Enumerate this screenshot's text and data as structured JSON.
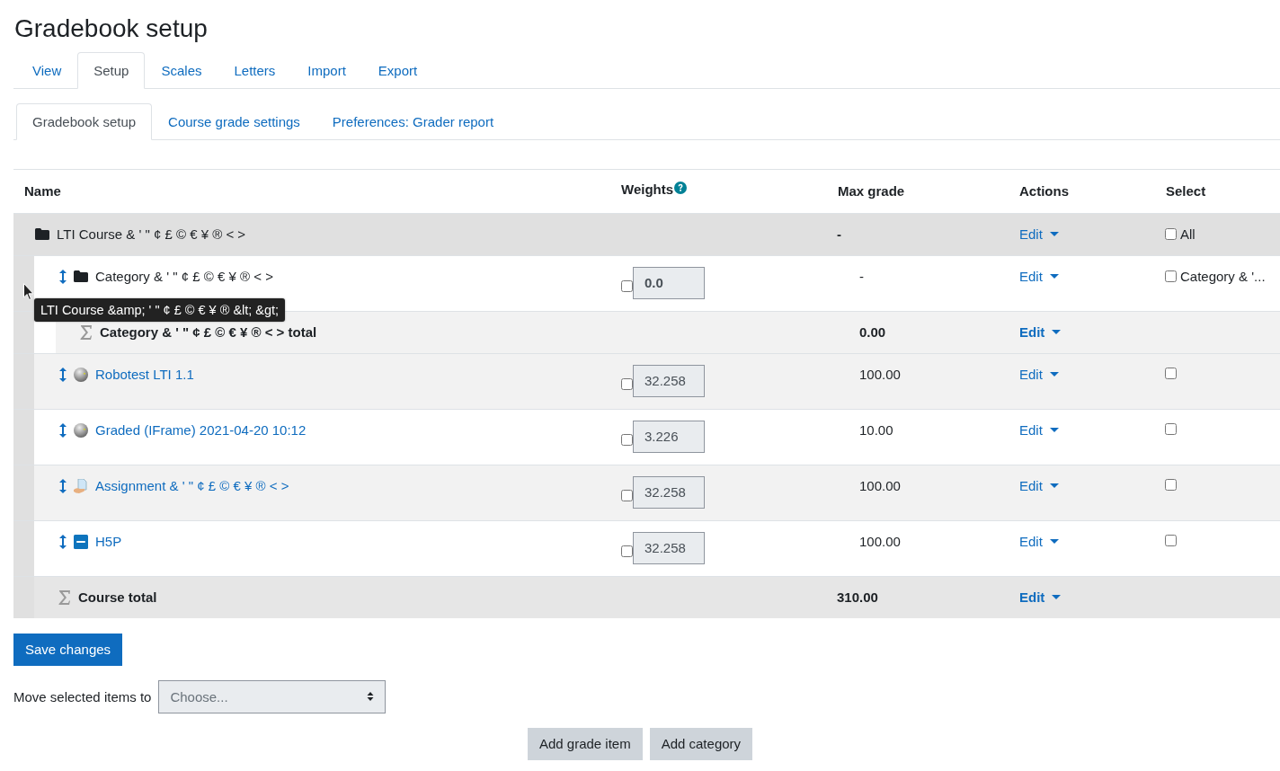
{
  "title": "Gradebook setup",
  "tabs": [
    {
      "label": "View",
      "selected": false
    },
    {
      "label": "Setup",
      "selected": true
    },
    {
      "label": "Scales",
      "selected": false
    },
    {
      "label": "Letters",
      "selected": false
    },
    {
      "label": "Import",
      "selected": false
    },
    {
      "label": "Export",
      "selected": false
    }
  ],
  "subtabs": [
    {
      "label": "Gradebook setup",
      "selected": true
    },
    {
      "label": "Course grade settings",
      "selected": false
    },
    {
      "label": "Preferences: Grader report",
      "selected": false
    }
  ],
  "columns": [
    "Name",
    "Weights",
    "Max grade",
    "Actions",
    "Select"
  ],
  "tree": {
    "kind": "course",
    "name": "LTI Course & ' \" ¢ £ © € ¥ ® < >",
    "max_grade": "-",
    "action": "Edit",
    "select_label": "All",
    "select_checked": false,
    "children": [
      {
        "kind": "category",
        "name": "Category & ' \" ¢ £ © € ¥ ® < >",
        "weight": "0.0",
        "weight_override": false,
        "max_grade": "-",
        "action": "Edit",
        "select_label": "Category & '...",
        "select_checked": false,
        "children": [
          {
            "kind": "total",
            "name": "Category & ' \" ¢ £ © € ¥ ® < > total",
            "max_grade": "0.00",
            "action": "Edit"
          }
        ]
      },
      {
        "kind": "lti",
        "name": "Robotest LTI 1.1",
        "weight": "32.258",
        "weight_override": false,
        "max_grade": "100.00",
        "action": "Edit",
        "select_checked": false
      },
      {
        "kind": "lti",
        "name": "Graded (IFrame) 2021-04-20 10:12",
        "weight": "3.226",
        "weight_override": false,
        "max_grade": "10.00",
        "action": "Edit",
        "select_checked": false
      },
      {
        "kind": "assign",
        "name": "Assignment & ' \" ¢ £ © € ¥ ® < >",
        "weight": "32.258",
        "weight_override": false,
        "max_grade": "100.00",
        "action": "Edit",
        "select_checked": false
      },
      {
        "kind": "h5p",
        "name": "H5P",
        "weight": "32.258",
        "weight_override": false,
        "max_grade": "100.00",
        "action": "Edit",
        "select_checked": false
      },
      {
        "kind": "total",
        "name": "Course total",
        "max_grade": "310.00",
        "action": "Edit"
      }
    ]
  },
  "tooltip": "LTI Course &amp; ' \" ¢ £ © € ¥ ® &lt; &gt;",
  "save_button": "Save changes",
  "move": {
    "label": "Move selected items to",
    "value": "Choose..."
  },
  "buttons": [
    "Add grade item",
    "Add category"
  ]
}
